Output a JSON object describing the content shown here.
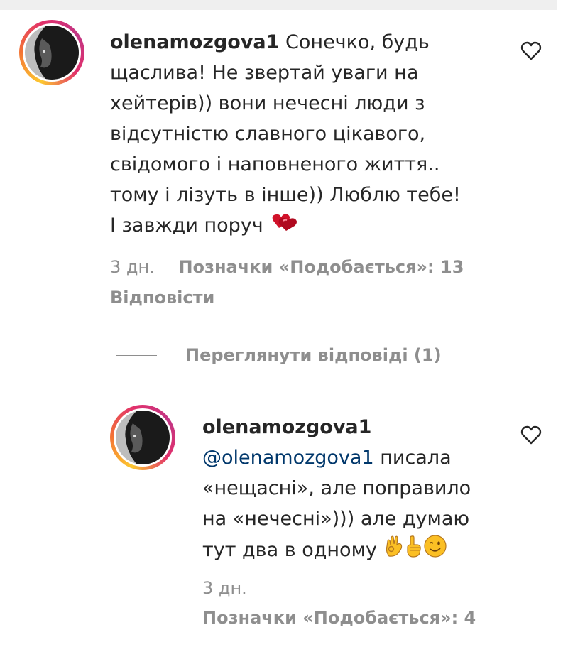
{
  "comments": [
    {
      "username": "olenamozgova1",
      "text_lines": [
        "Сонечко, будь",
        "щаслива! Не звертай уваги на",
        "хейтерів)) вони нечесні люди з",
        "відсутністю славного цікавого,",
        "свідомого і наповненого життя..",
        "тому і лізуть в інше)) Люблю тебе!",
        "І завжди поруч"
      ],
      "emoji": [
        "hearts-emoji"
      ],
      "time": "3 дн.",
      "likes": "Позначки «Подобається»: 13",
      "reply_label": "Відповісти",
      "view_replies_label": "Переглянути відповіді (1)"
    },
    {
      "username": "olenamozgova1",
      "mention": "@olenamozgova1",
      "text_lines": [
        " писала",
        "«нещасні», але поправило",
        "на «нечесні»))) але думаю",
        "тут два в одному"
      ],
      "emoji": [
        "ok-hand-emoji",
        "index-up-emoji",
        "wink-emoji"
      ],
      "time": "3 дн.",
      "likes": "Позначки «Подобається»: 4"
    }
  ],
  "colors": {
    "text": "#262626",
    "secondary": "#8e8e8e",
    "mention": "#00376b",
    "story_ring": [
      "#fdc830",
      "#f37335",
      "#e1306c",
      "#c13584"
    ]
  }
}
